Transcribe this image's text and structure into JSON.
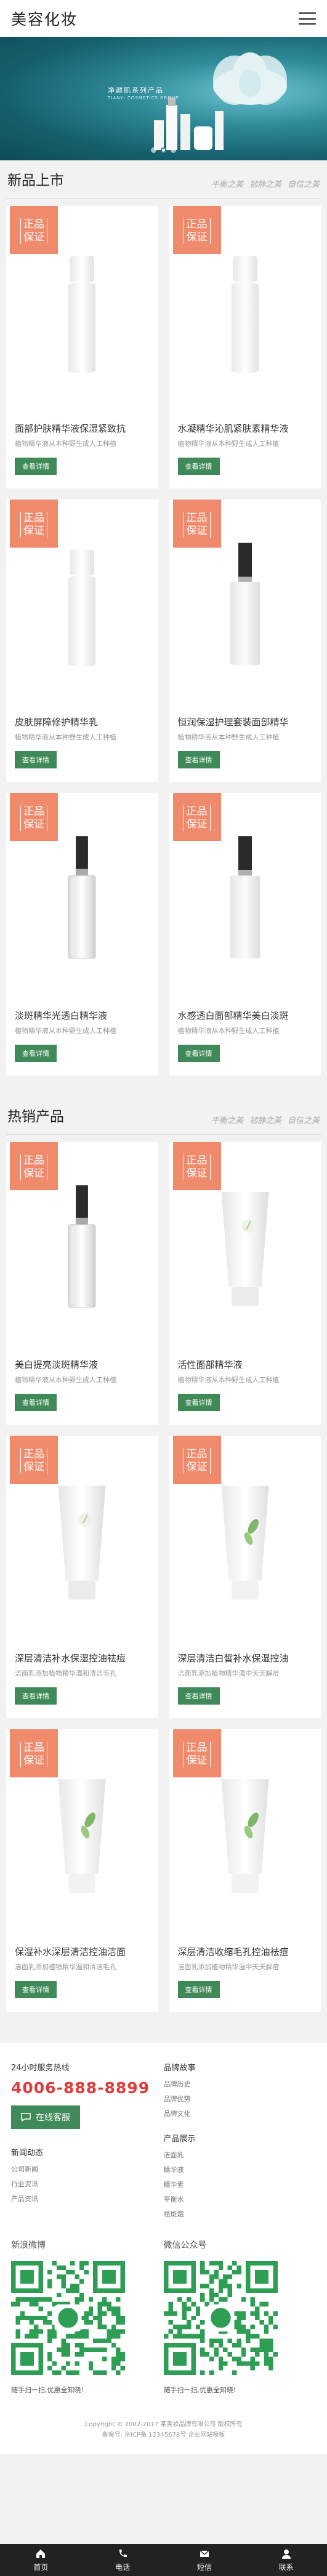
{
  "header": {
    "logo": "美容化妆"
  },
  "banner": {
    "title": "净颜肌系列产品",
    "subtitle": "TIANYI COSMETICS GROUP",
    "slide_count": 3,
    "active_slide": 2
  },
  "new_products": {
    "title": "新品上市",
    "tags": [
      "平衡之美",
      "韧静之美",
      "自信之美"
    ],
    "items": [
      {
        "badge": [
          "正品",
          "保证"
        ],
        "name": "面部护肤精华液保湿紧致抗",
        "desc": "植物精华液从本种野生成人工种植",
        "button": "查看详情",
        "type": "white"
      },
      {
        "badge": [
          "正品",
          "保证"
        ],
        "name": "水凝精华沁肌紧肤素精华液",
        "desc": "植物精华液从本种野生成人工种植",
        "button": "查看详情",
        "type": "white"
      },
      {
        "badge": [
          "正品",
          "保证"
        ],
        "name": "皮肤屏障修护精华乳",
        "desc": "植物精华液从本种野生成人工种植",
        "button": "查看详情",
        "type": "white"
      },
      {
        "badge": [
          "正品",
          "保证"
        ],
        "name": "恒润保湿护理套装面部精华",
        "desc": "植物精华液从本种野生成人工种植",
        "button": "查看详情",
        "type": "frosted"
      },
      {
        "badge": [
          "正品",
          "保证"
        ],
        "name": "淡斑精华光透白精华液",
        "desc": "植物精华液从本种野生成人工种植",
        "button": "查看详情",
        "type": "clear"
      },
      {
        "badge": [
          "正品",
          "保证"
        ],
        "name": "水感透白面部精华美白淡斑",
        "desc": "植物精华液从本种野生成人工种植",
        "button": "查看详情",
        "type": "frosted"
      }
    ]
  },
  "hot_products": {
    "title": "热销产品",
    "tags": [
      "平衡之美",
      "韧静之美",
      "自信之美"
    ],
    "items": [
      {
        "badge": [
          "正品",
          "保证"
        ],
        "name": "美白提亮淡斑精华液",
        "desc": "植物精华液从本种野生成人工种植",
        "button": "查看详情",
        "type": "clear"
      },
      {
        "badge": [
          "正品",
          "保证"
        ],
        "name": "活性面部精华液",
        "desc": "植物精华液从本种野生成人工种植",
        "button": "查看详情",
        "type": "tube-white"
      },
      {
        "badge": [
          "正品",
          "保证"
        ],
        "name": "深层清洁补水保湿控油祛痘",
        "desc": "洁面乳添加植物精华温和清洁毛孔",
        "button": "查看详情",
        "type": "tube-white"
      },
      {
        "badge": [
          "正品",
          "保证"
        ],
        "name": "深层清洁白皙补水保湿控油",
        "desc": "洁面乳添加植物精华温中天天解痘",
        "button": "查看详情",
        "type": "tube-leaf"
      },
      {
        "badge": [
          "正品",
          "保证"
        ],
        "name": "保湿补水深层清洁控油洁面",
        "desc": "洁面乳添加植物精华温和清洁毛孔",
        "button": "查看详情",
        "type": "tube-leaf"
      },
      {
        "badge": [
          "正品",
          "保证"
        ],
        "name": "深层清洁收缩毛孔控油祛痘",
        "desc": "洁面乳添加植物精华温中天天解痘",
        "button": "查看详情",
        "type": "tube-leaf"
      }
    ]
  },
  "footer": {
    "hotline_label": "24小时服务热线",
    "hotline": "4006-888-8899",
    "consult_button": "在线客服",
    "brand_head": "品牌故事",
    "brand_links": [
      "品牌历史",
      "品牌优势",
      "品牌文化"
    ],
    "news_head": "新闻动态",
    "news_links": [
      "公司新闻",
      "行业资讯",
      "产品资讯"
    ],
    "product_head": "产品展示",
    "product_links": [
      "洁面乳",
      "精华液",
      "精华素",
      "平衡水",
      "祛斑霜"
    ],
    "weibo_title": "新浪微博",
    "wechat_title": "微信公众号",
    "qr_caption": "随手扫一扫,优惠全知晓!",
    "copyright_1": "Copyright © 2002-2017 某美妆品牌有限公司 版权所有",
    "copyright_2": "备案号: 京ICP备 12345678号 企业网站模板"
  },
  "bottom_nav": {
    "items": [
      {
        "label": "首页",
        "icon": "home-icon"
      },
      {
        "label": "电话",
        "icon": "phone-icon"
      },
      {
        "label": "短信",
        "icon": "message-icon"
      },
      {
        "label": "联系",
        "icon": "user-icon"
      }
    ]
  },
  "colors": {
    "badge": "#f08a6c",
    "button": "#3f8a58",
    "hotline": "#e03a3a",
    "banner": "#2f8a98",
    "nav": "#222222"
  }
}
